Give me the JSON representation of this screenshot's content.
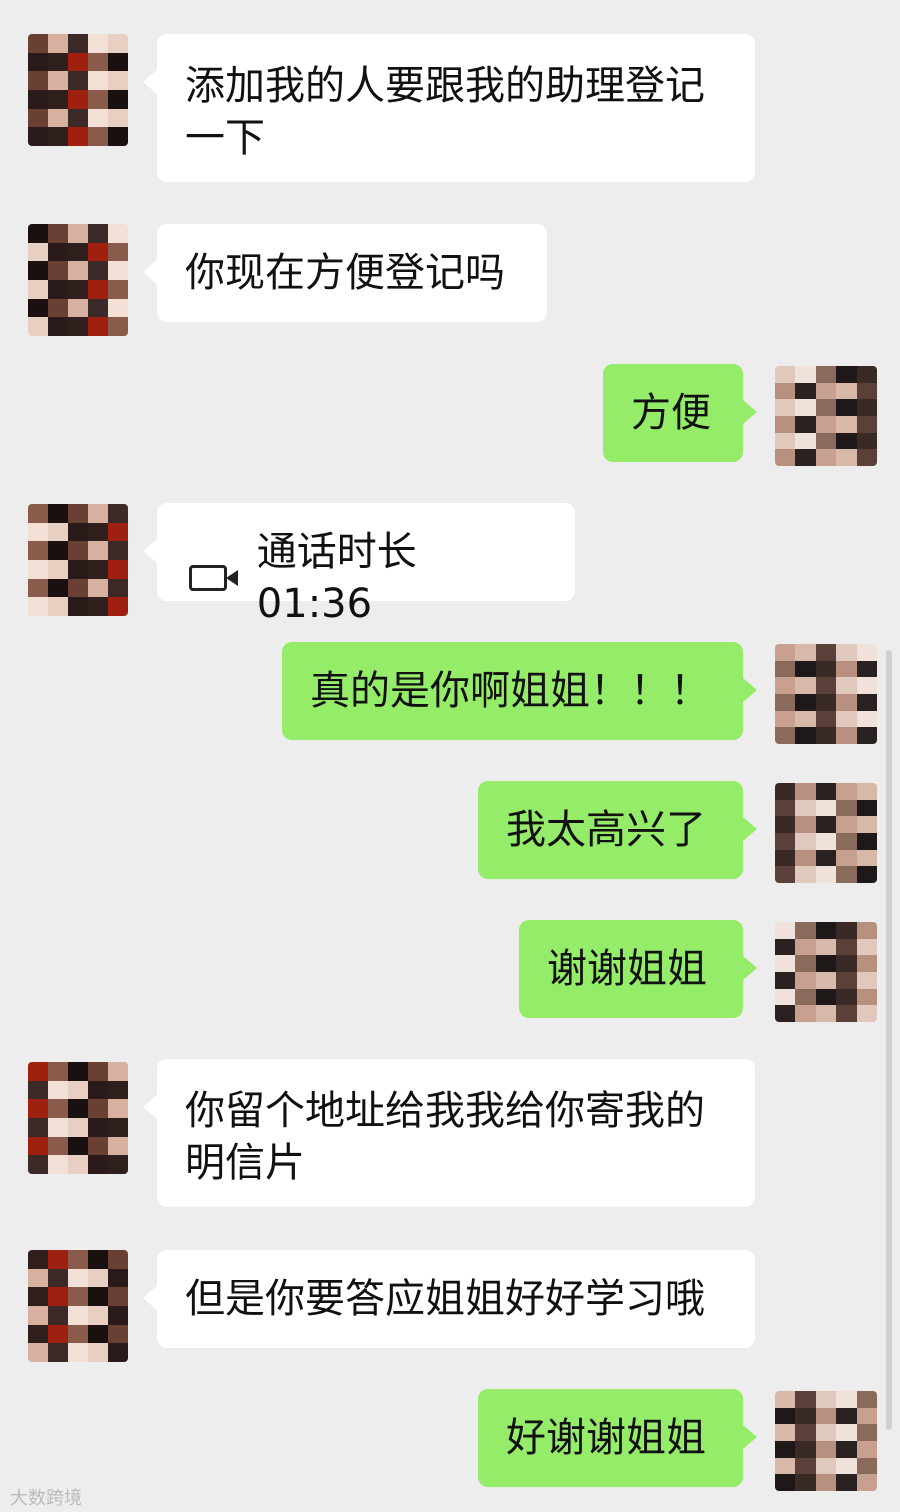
{
  "messages": [
    {
      "side": "in",
      "text": "添加我的人要跟我的助理登记\n一下"
    },
    {
      "side": "in",
      "text": "你现在方便登记吗"
    },
    {
      "side": "out",
      "text": "方便"
    },
    {
      "side": "in",
      "type": "call",
      "text": "通话时长 01:36",
      "icon": "video-camera-icon"
    },
    {
      "side": "out",
      "text": "真的是你啊姐姐！！！"
    },
    {
      "side": "out",
      "text": "我太高兴了"
    },
    {
      "side": "out",
      "text": "谢谢姐姐"
    },
    {
      "side": "in",
      "text": "你留个地址给我我给你寄我的\n明信片"
    },
    {
      "side": "in",
      "text": "但是你要答应姐姐好好学习哦"
    },
    {
      "side": "out",
      "text": "好谢谢姐姐"
    }
  ],
  "watermark": "大数跨境",
  "colors": {
    "background": "#ededed",
    "incoming": "#ffffff",
    "outgoing": "#95ec69"
  }
}
